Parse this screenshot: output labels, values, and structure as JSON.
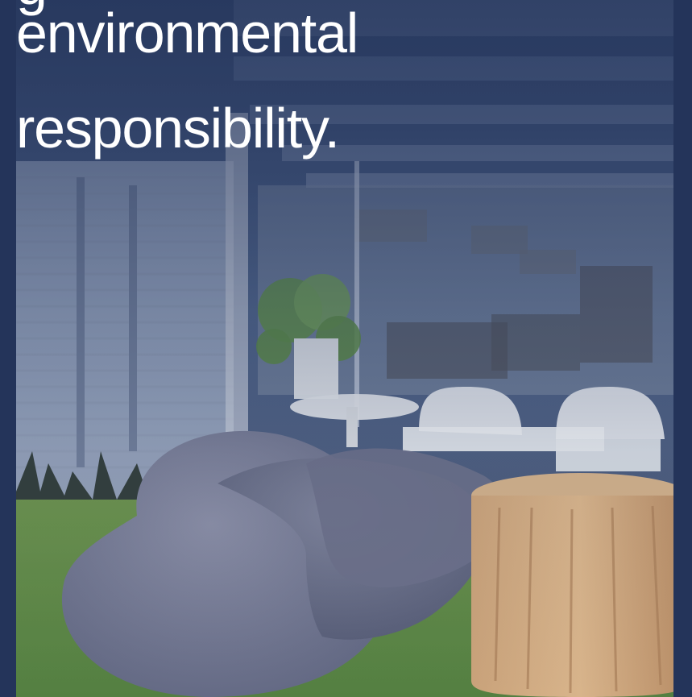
{
  "hero": {
    "headline_lines": [
      "g",
      "environmental",
      "responsibility."
    ],
    "image_alt": "Office lounge with bean bags, a wooden stump table, plants and white chairs",
    "colors": {
      "page_background": "#24345a",
      "overlay": "#24345a",
      "headline_text": "#ffffff"
    }
  }
}
